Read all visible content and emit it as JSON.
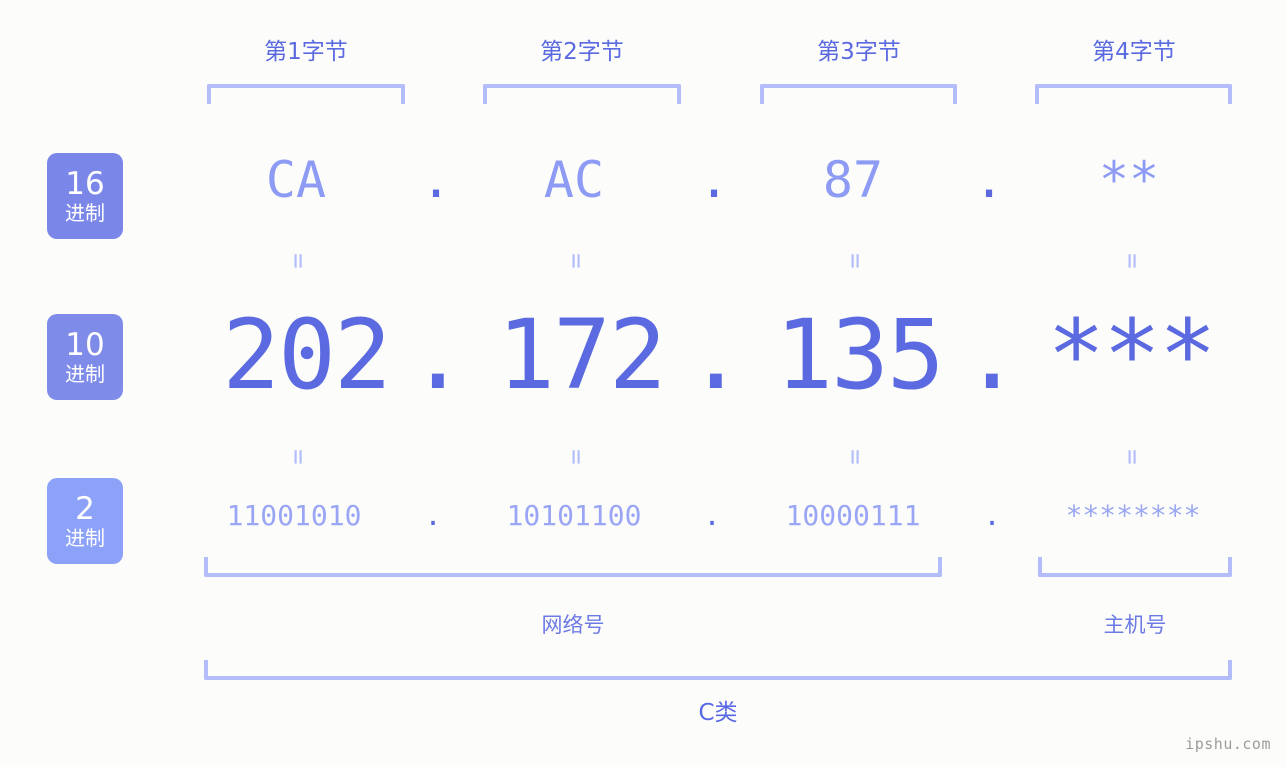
{
  "colors": {
    "background": "#fcfdfa",
    "accent_strong": "#5b6ae0",
    "accent_mid": "#8d9bf4",
    "accent_light": "#b4bdfb",
    "badge_dark": "#7b87e8",
    "badge_light": "#8ca1f8",
    "watermark": "#9b9b9b"
  },
  "byte_headers": [
    {
      "label": "第1字节"
    },
    {
      "label": "第2字节"
    },
    {
      "label": "第3字节"
    },
    {
      "label": "第4字节"
    }
  ],
  "radix_badges": [
    {
      "number": "16",
      "word": "进制",
      "color": "#7b87e8"
    },
    {
      "number": "10",
      "word": "进制",
      "color": "#7f8be9"
    },
    {
      "number": "2",
      "word": "进制",
      "color": "#8ca1f8"
    }
  ],
  "rows": {
    "hex": {
      "values": [
        "CA",
        "AC",
        "87",
        "**"
      ],
      "separators": [
        ".",
        ".",
        "."
      ]
    },
    "dec": {
      "values": [
        "202",
        "172",
        "135",
        "***"
      ],
      "separators": [
        ".",
        ".",
        "."
      ]
    },
    "bin": {
      "values": [
        "11001010",
        "10101100",
        "10000111",
        "********"
      ],
      "separators": [
        ".",
        ".",
        "."
      ]
    }
  },
  "equals": {
    "glyph": "=",
    "count_per_row": 4
  },
  "sections": [
    {
      "label": "网络号"
    },
    {
      "label": "主机号"
    }
  ],
  "ip_class": {
    "label": "C类"
  },
  "watermark": {
    "text": "ipshu.com"
  }
}
